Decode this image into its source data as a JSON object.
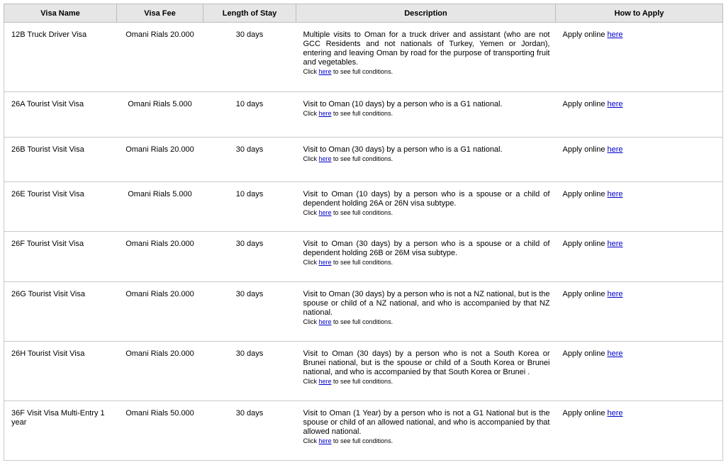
{
  "headers": [
    "Visa Name",
    "Visa Fee",
    "Length of Stay",
    "Description",
    "How to Apply"
  ],
  "apply_prefix": "Apply online ",
  "link_text": "here",
  "cond_prefix": "Click ",
  "cond_suffix": " to see full conditions.",
  "rows": [
    {
      "name": "12B Truck Driver Visa",
      "fee": "Omani Rials 20.000",
      "stay": "30 days",
      "description": "Multiple visits to Oman for a truck driver and assistant (who are not GCC Residents and not nationals of Turkey, Yemen or Jordan), entering and leaving Oman by road for the purpose of transporting fruit and vegetables."
    },
    {
      "name": "26A Tourist Visit Visa",
      "fee": "Omani Rials 5.000",
      "stay": "10 days",
      "description": "Visit to Oman (10 days) by a person who is a G1 national."
    },
    {
      "name": "26B Tourist Visit Visa",
      "fee": "Omani Rials 20.000",
      "stay": "30 days",
      "description": "Visit to Oman (30 days) by a person who is a G1 national."
    },
    {
      "name": "26E Tourist Visit Visa",
      "fee": "Omani Rials 5.000",
      "stay": "10 days",
      "description": "Visit to Oman (10 days) by a person who is a spouse or a child of dependent holding 26A or 26N visa subtype."
    },
    {
      "name": "26F Tourist Visit Visa",
      "fee": "Omani Rials 20.000",
      "stay": "30 days",
      "description": "Visit to Oman (30 days) by a person who is a spouse or a child of dependent holding 26B or 26M visa subtype."
    },
    {
      "name": "26G Tourist Visit Visa",
      "fee": "Omani Rials 20.000",
      "stay": "30 days",
      "description": "Visit to Oman (30 days) by a person who is not a NZ national, but is the spouse or child of a NZ national, and who is accompanied by that NZ national."
    },
    {
      "name": "26H Tourist Visit Visa",
      "fee": "Omani Rials 20.000",
      "stay": "30 days",
      "description": "Visit to Oman (30 days) by a person who is not a South Korea or Brunei national, but is the spouse or child of a South Korea or Brunei national, and who is accompanied by that South Korea or Brunei ."
    },
    {
      "name": "36F Visit Visa Multi-Entry 1 year",
      "fee": "Omani Rials 50.000",
      "stay": "30 days",
      "description": "Visit to Oman (1 Year) by a person who is not a G1 National but is the spouse or child of an allowed national, and who is accompanied by that allowed national."
    }
  ]
}
